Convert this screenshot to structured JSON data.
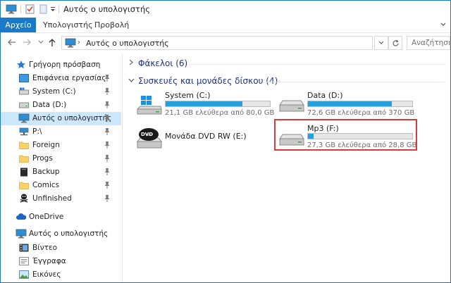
{
  "window": {
    "title": "Αυτός ο υπολογιστής",
    "colors": {
      "accent": "#1979ca",
      "selection": "#cce8ff",
      "bar_fill": "#26a0da",
      "highlight": "#d83b3b",
      "group_head": "#1e3287"
    }
  },
  "quick_access": {
    "icons": [
      "computer-icon",
      "properties-check-icon",
      "new-folder-icon",
      "customize-dropdown-icon"
    ]
  },
  "ribbon": {
    "file_label": "Αρχείο",
    "tabs": [
      "Υπολογιστής",
      "Προβολή"
    ]
  },
  "address": {
    "path": "Αυτός ο υπολογιστής",
    "search_placeholder": "Αναζήτηση: Α"
  },
  "sidebar": {
    "quick_access_label": "Γρήγορη πρόσβαση",
    "pinned": [
      {
        "label": "Επιφάνεια εργασίας",
        "icon": "desktop-icon"
      },
      {
        "label": "System (C:)",
        "icon": "system-drive-icon"
      },
      {
        "label": "Data (D:)",
        "icon": "hard-drive-icon"
      },
      {
        "label": "Αυτός ο υπολογιστής",
        "icon": "computer-icon"
      },
      {
        "label": "P:\\",
        "icon": "network-drive-icon"
      },
      {
        "label": "Foreign",
        "icon": "folder-icon"
      },
      {
        "label": "Progs",
        "icon": "folder-icon"
      },
      {
        "label": "Backup",
        "icon": "backup-icon"
      },
      {
        "label": "Comics",
        "icon": "folder-icon"
      },
      {
        "label": "Unfinished",
        "icon": "pirate-folder-icon"
      }
    ],
    "onedrive_label": "OneDrive",
    "thispc_label": "Αυτός ο υπολογιστής",
    "thispc_children": [
      {
        "label": "Βίντεο",
        "icon": "video-icon"
      },
      {
        "label": "Έγγραφα",
        "icon": "documents-icon"
      },
      {
        "label": "Εικόνες",
        "icon": "pictures-icon"
      }
    ]
  },
  "content": {
    "folders_group": "Φάκελοι (6)",
    "devices_group": "Συσκευές και μονάδες δίσκου (4)",
    "drives": [
      {
        "name": "System (C:)",
        "free": "21,1 GB ελεύθερα από 80,0 GB",
        "used_fraction": 0.736,
        "icon": "windows-drive-icon"
      },
      {
        "name": "Data (D:)",
        "free": "72,6 GB ελεύθερα από 370 GB",
        "used_fraction": 0.804,
        "icon": "hard-drive-icon"
      },
      {
        "name": "Μονάδα DVD RW (E:)",
        "icon": "dvd-drive-icon"
      },
      {
        "name": "Mp3 (F:)",
        "free": "27,3 GB ελεύθερα από 28,8 GB",
        "used_fraction": 0.052,
        "icon": "hard-drive-icon"
      }
    ]
  }
}
